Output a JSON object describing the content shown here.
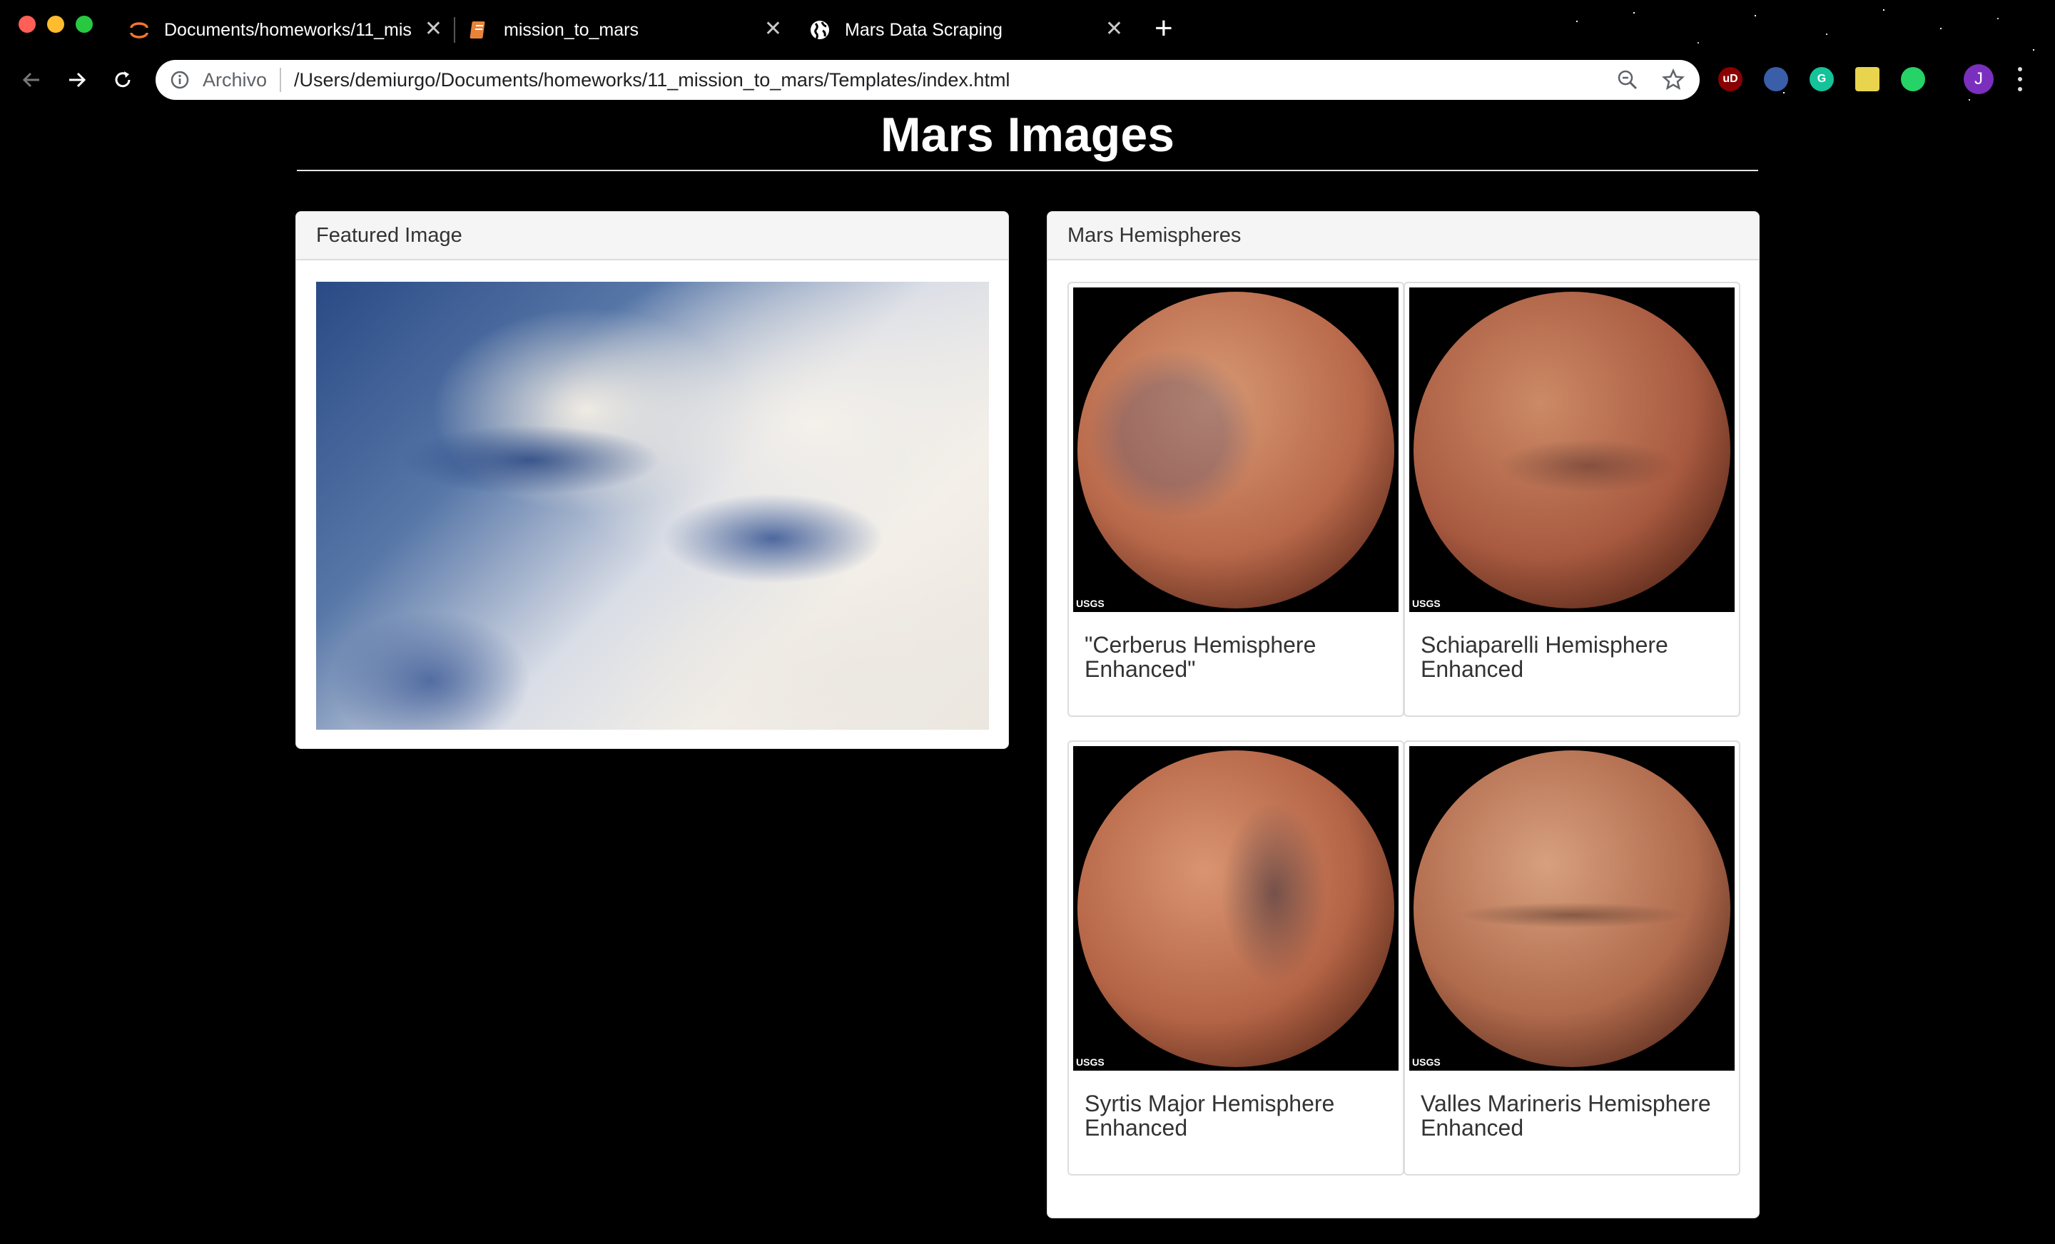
{
  "browser": {
    "tabs": [
      {
        "title": "Documents/homeworks/11_mis",
        "close": "✕"
      },
      {
        "title": "mission_to_mars",
        "close": "✕"
      },
      {
        "title": "Mars Data Scraping",
        "close": "✕"
      }
    ],
    "new_tab": "+",
    "address_scheme": "Archivo",
    "address_url": "/Users/demiurgo/Documents/homeworks/11_mission_to_mars/Templates/index.html",
    "avatar_initial": "J",
    "extensions": [
      {
        "name": "ublock-icon",
        "label": "uD",
        "color": "#8b0000"
      },
      {
        "name": "owl-icon",
        "label": "",
        "color": "#3a5ea8"
      },
      {
        "name": "grammarly-icon",
        "label": "G",
        "color": "#15c39a"
      },
      {
        "name": "sticky-note-icon",
        "label": "",
        "color": "#e8d44d"
      },
      {
        "name": "whatsapp-icon",
        "label": "",
        "color": "#25d366"
      }
    ]
  },
  "page": {
    "title": "Mars Images",
    "featured": {
      "heading": "Featured Image"
    },
    "hemispheres": {
      "heading": "Mars Hemispheres",
      "items": [
        {
          "caption": "\"Cerberus Hemisphere Enhanced\"",
          "badge": "USGS"
        },
        {
          "caption": "Schiaparelli Hemisphere Enhanced",
          "badge": "USGS"
        },
        {
          "caption": "Syrtis Major Hemisphere Enhanced",
          "badge": "USGS"
        },
        {
          "caption": "Valles Marineris Hemisphere Enhanced",
          "badge": "USGS"
        }
      ]
    }
  }
}
